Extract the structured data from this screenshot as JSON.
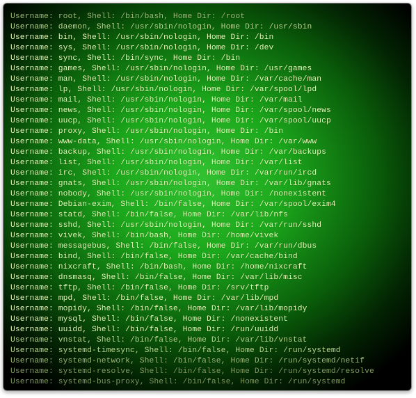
{
  "label_user": "Username:",
  "label_shell": "Shell:",
  "label_home": "Home Dir:",
  "users": [
    {
      "u": "root",
      "s": "/bin/bash",
      "h": "/root",
      "dim": "d2"
    },
    {
      "u": "daemon",
      "s": "/usr/sbin/nologin",
      "h": "/usr/sbin",
      "dim": "d1"
    },
    {
      "u": "bin",
      "s": "/usr/sbin/nologin",
      "h": "/bin",
      "dim": ""
    },
    {
      "u": "sys",
      "s": "/usr/sbin/nologin",
      "h": "/dev",
      "dim": ""
    },
    {
      "u": "sync",
      "s": "/bin/sync",
      "h": "/bin",
      "dim": ""
    },
    {
      "u": "games",
      "s": "/usr/sbin/nologin",
      "h": "/usr/games",
      "dim": ""
    },
    {
      "u": "man",
      "s": "/usr/sbin/nologin",
      "h": "/var/cache/man",
      "dim": ""
    },
    {
      "u": "lp",
      "s": "/usr/sbin/nologin",
      "h": "/var/spool/lpd",
      "dim": ""
    },
    {
      "u": "mail",
      "s": "/usr/sbin/nologin",
      "h": "/var/mail",
      "dim": ""
    },
    {
      "u": "news",
      "s": "/usr/sbin/nologin",
      "h": "/var/spool/news",
      "dim": ""
    },
    {
      "u": "uucp",
      "s": "/usr/sbin/nologin",
      "h": "/var/spool/uucp",
      "dim": ""
    },
    {
      "u": "proxy",
      "s": "/usr/sbin/nologin",
      "h": "/bin",
      "dim": ""
    },
    {
      "u": "www-data",
      "s": "/usr/sbin/nologin",
      "h": "/var/www",
      "dim": ""
    },
    {
      "u": "backup",
      "s": "/usr/sbin/nologin",
      "h": "/var/backups",
      "dim": ""
    },
    {
      "u": "list",
      "s": "/usr/sbin/nologin",
      "h": "/var/list",
      "dim": ""
    },
    {
      "u": "irc",
      "s": "/usr/sbin/nologin",
      "h": "/var/run/ircd",
      "dim": ""
    },
    {
      "u": "gnats",
      "s": "/usr/sbin/nologin",
      "h": "/var/lib/gnats",
      "dim": ""
    },
    {
      "u": "nobody",
      "s": "/usr/sbin/nologin",
      "h": "/nonexistent",
      "dim": ""
    },
    {
      "u": "Debian-exim",
      "s": "/bin/false",
      "h": "/var/spool/exim4",
      "dim": ""
    },
    {
      "u": "statd",
      "s": "/bin/false",
      "h": "/var/lib/nfs",
      "dim": ""
    },
    {
      "u": "sshd",
      "s": "/usr/sbin/nologin",
      "h": "/var/run/sshd",
      "dim": ""
    },
    {
      "u": "vivek",
      "s": "/bin/bash",
      "h": "/home/vivek",
      "dim": ""
    },
    {
      "u": "messagebus",
      "s": "/bin/false",
      "h": "/var/run/dbus",
      "dim": ""
    },
    {
      "u": "bind",
      "s": "/bin/false",
      "h": "/var/cache/bind",
      "dim": ""
    },
    {
      "u": "nixcraft",
      "s": "/bin/bash",
      "h": "/home/nixcraft",
      "dim": ""
    },
    {
      "u": "dnsmasq",
      "s": "/bin/false",
      "h": "/var/lib/misc",
      "dim": ""
    },
    {
      "u": "tftp",
      "s": "/bin/false",
      "h": "/srv/tftp",
      "dim": ""
    },
    {
      "u": "mpd",
      "s": "/bin/false",
      "h": "/var/lib/mpd",
      "dim": ""
    },
    {
      "u": "mopidy",
      "s": "/bin/false",
      "h": "/var/lib/mopidy",
      "dim": ""
    },
    {
      "u": "mysql",
      "s": "/bin/false",
      "h": "/nonexistent",
      "dim": ""
    },
    {
      "u": "uuidd",
      "s": "/bin/false",
      "h": "/run/uuidd",
      "dim": ""
    },
    {
      "u": "vnstat",
      "s": "/bin/false",
      "h": "/var/lib/vnstat",
      "dim": "d1"
    },
    {
      "u": "systemd-timesync",
      "s": "/bin/false",
      "h": "/run/systemd",
      "dim": "d1"
    },
    {
      "u": "systemd-network",
      "s": "/bin/false",
      "h": "/run/systemd/netif",
      "dim": "d2"
    },
    {
      "u": "systemd-resolve",
      "s": "/bin/false",
      "h": "/run/systemd/resolve",
      "dim": "d3"
    },
    {
      "u": "systemd-bus-proxy",
      "s": "/bin/false",
      "h": "/run/systemd",
      "dim": "d3"
    }
  ]
}
